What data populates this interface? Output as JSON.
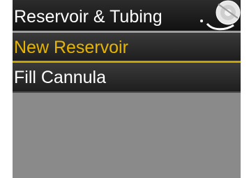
{
  "header": {
    "title": "Reservoir & Tubing",
    "icon": "reservoir-tubing-icon"
  },
  "menu": {
    "items": [
      {
        "label": "New Reservoir",
        "selected": true
      },
      {
        "label": "Fill Cannula",
        "selected": false
      }
    ]
  },
  "colors": {
    "selected_text": "#e8b400",
    "normal_text": "#ffffff",
    "background": "#8a8a8a",
    "selection_underline": "#c9a300"
  }
}
